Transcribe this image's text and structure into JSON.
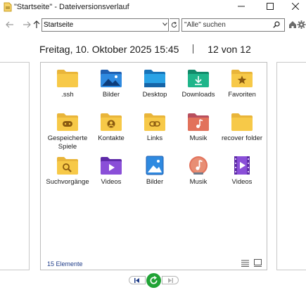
{
  "window": {
    "title": "\"Startseite\" - Dateiversionsverlauf"
  },
  "nav": {
    "address": "Startseite",
    "search_placeholder": "\"Alle\" suchen"
  },
  "header": {
    "datetime": "Freitag, 10. Oktober 2025 15:45",
    "position": "12 von 12"
  },
  "items": [
    {
      "label": "​.ssh",
      "icon": "folder-icon"
    },
    {
      "label": "Bilder",
      "icon": "pictures-folder-icon"
    },
    {
      "label": "Desktop",
      "icon": "desktop-folder-icon"
    },
    {
      "label": "Downloads",
      "icon": "downloads-folder-icon"
    },
    {
      "label": "Favoriten",
      "icon": "favorites-folder-icon"
    },
    {
      "label": "Gespeicherte Spiele",
      "icon": "saved-games-folder-icon"
    },
    {
      "label": "Kontakte",
      "icon": "contacts-folder-icon"
    },
    {
      "label": "Links",
      "icon": "links-folder-icon"
    },
    {
      "label": "Musik",
      "icon": "music-folder-icon"
    },
    {
      "label": "recover folder",
      "icon": "folder-icon"
    },
    {
      "label": "Suchvorgänge",
      "icon": "searches-folder-icon"
    },
    {
      "label": "Videos",
      "icon": "videos-folder-icon"
    },
    {
      "label": "Bilder",
      "icon": "pictures-library-icon"
    },
    {
      "label": "Musik",
      "icon": "music-library-icon"
    },
    {
      "label": "Videos",
      "icon": "videos-library-icon"
    }
  ],
  "status": {
    "count": "15 Elemente"
  },
  "colors": {
    "folder": "#f7c948",
    "accent_blue": "#1f3c88",
    "restore_green": "#21a336"
  }
}
